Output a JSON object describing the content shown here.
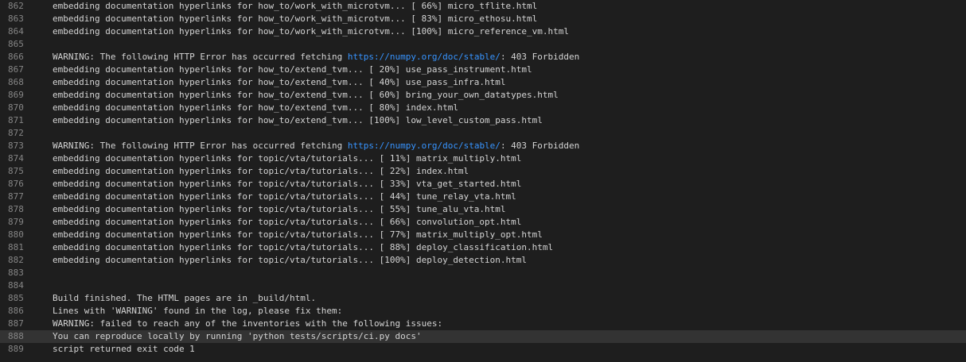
{
  "colors": {
    "background": "#1e1e1e",
    "text": "#d4d4d4",
    "line_number": "#858585",
    "link": "#3794ff",
    "highlight_row": "#333333"
  },
  "log": {
    "lines": [
      {
        "n": "862",
        "parts": [
          {
            "t": "embedding documentation hyperlinks for how_to/work_with_microtvm... [ 66%] micro_tflite.html"
          }
        ]
      },
      {
        "n": "863",
        "parts": [
          {
            "t": "embedding documentation hyperlinks for how_to/work_with_microtvm... [ 83%] micro_ethosu.html"
          }
        ]
      },
      {
        "n": "864",
        "parts": [
          {
            "t": "embedding documentation hyperlinks for how_to/work_with_microtvm... [100%] micro_reference_vm.html"
          }
        ]
      },
      {
        "n": "865",
        "parts": []
      },
      {
        "n": "866",
        "parts": [
          {
            "t": "WARNING: The following HTTP Error has occurred fetching "
          },
          {
            "t": "https://numpy.org/doc/stable/",
            "link": true
          },
          {
            "t": ": 403 Forbidden"
          }
        ]
      },
      {
        "n": "867",
        "parts": [
          {
            "t": "embedding documentation hyperlinks for how_to/extend_tvm... [ 20%] use_pass_instrument.html"
          }
        ]
      },
      {
        "n": "868",
        "parts": [
          {
            "t": "embedding documentation hyperlinks for how_to/extend_tvm... [ 40%] use_pass_infra.html"
          }
        ]
      },
      {
        "n": "869",
        "parts": [
          {
            "t": "embedding documentation hyperlinks for how_to/extend_tvm... [ 60%] bring_your_own_datatypes.html"
          }
        ]
      },
      {
        "n": "870",
        "parts": [
          {
            "t": "embedding documentation hyperlinks for how_to/extend_tvm... [ 80%] index.html"
          }
        ]
      },
      {
        "n": "871",
        "parts": [
          {
            "t": "embedding documentation hyperlinks for how_to/extend_tvm... [100%] low_level_custom_pass.html"
          }
        ]
      },
      {
        "n": "872",
        "parts": []
      },
      {
        "n": "873",
        "parts": [
          {
            "t": "WARNING: The following HTTP Error has occurred fetching "
          },
          {
            "t": "https://numpy.org/doc/stable/",
            "link": true
          },
          {
            "t": ": 403 Forbidden"
          }
        ]
      },
      {
        "n": "874",
        "parts": [
          {
            "t": "embedding documentation hyperlinks for topic/vta/tutorials... [ 11%] matrix_multiply.html"
          }
        ]
      },
      {
        "n": "875",
        "parts": [
          {
            "t": "embedding documentation hyperlinks for topic/vta/tutorials... [ 22%] index.html"
          }
        ]
      },
      {
        "n": "876",
        "parts": [
          {
            "t": "embedding documentation hyperlinks for topic/vta/tutorials... [ 33%] vta_get_started.html"
          }
        ]
      },
      {
        "n": "877",
        "parts": [
          {
            "t": "embedding documentation hyperlinks for topic/vta/tutorials... [ 44%] tune_relay_vta.html"
          }
        ]
      },
      {
        "n": "878",
        "parts": [
          {
            "t": "embedding documentation hyperlinks for topic/vta/tutorials... [ 55%] tune_alu_vta.html"
          }
        ]
      },
      {
        "n": "879",
        "parts": [
          {
            "t": "embedding documentation hyperlinks for topic/vta/tutorials... [ 66%] convolution_opt.html"
          }
        ]
      },
      {
        "n": "880",
        "parts": [
          {
            "t": "embedding documentation hyperlinks for topic/vta/tutorials... [ 77%] matrix_multiply_opt.html"
          }
        ]
      },
      {
        "n": "881",
        "parts": [
          {
            "t": "embedding documentation hyperlinks for topic/vta/tutorials... [ 88%] deploy_classification.html"
          }
        ]
      },
      {
        "n": "882",
        "parts": [
          {
            "t": "embedding documentation hyperlinks for topic/vta/tutorials... [100%] deploy_detection.html"
          }
        ]
      },
      {
        "n": "883",
        "parts": []
      },
      {
        "n": "884",
        "parts": []
      },
      {
        "n": "885",
        "parts": [
          {
            "t": "Build finished. The HTML pages are in _build/html."
          }
        ]
      },
      {
        "n": "886",
        "parts": [
          {
            "t": "Lines with 'WARNING' found in the log, please fix them:"
          }
        ]
      },
      {
        "n": "887",
        "parts": [
          {
            "t": "WARNING: failed to reach any of the inventories with the following issues:"
          }
        ]
      },
      {
        "n": "888",
        "highlight": true,
        "parts": [
          {
            "t": "You can reproduce locally by running 'python tests/scripts/ci.py docs'"
          }
        ]
      },
      {
        "n": "889",
        "parts": [
          {
            "t": "script returned exit code 1"
          }
        ]
      }
    ]
  }
}
